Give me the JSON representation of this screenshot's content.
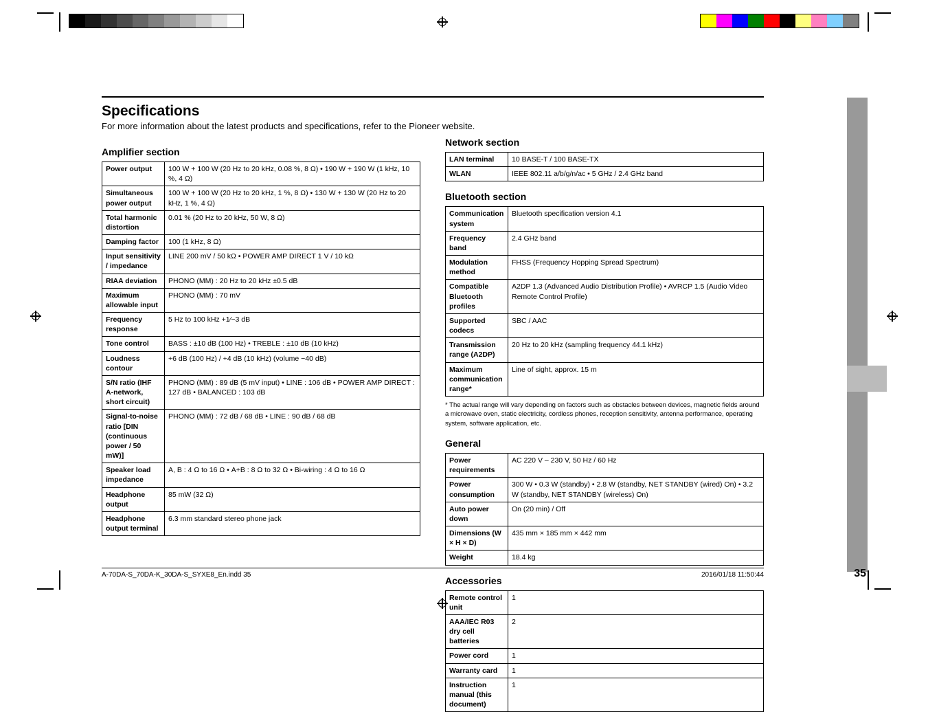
{
  "header": {
    "title": "Specifications",
    "subtitle": "For more information about the latest products and specifications, refer to the Pioneer website."
  },
  "amp": {
    "heading": "Amplifier section",
    "rows": [
      [
        "Power output",
        "100 W + 100 W (20 Hz to 20 kHz, 0.08 %, 8 Ω) • 190 W + 190 W (1 kHz, 10 %, 4 Ω)"
      ],
      [
        "Simultaneous power output",
        "100 W + 100 W (20 Hz to 20 kHz, 1 %, 8 Ω) • 130 W + 130 W (20 Hz to 20 kHz, 1 %, 4 Ω)"
      ],
      [
        "Total harmonic distortion",
        "0.01 % (20 Hz to 20 kHz, 50 W, 8 Ω)"
      ],
      [
        "Damping factor",
        "100 (1 kHz, 8 Ω)"
      ],
      [
        "Input sensitivity / impedance",
        "LINE  200 mV / 50 kΩ • POWER AMP DIRECT  1 V / 10 kΩ"
      ],
      [
        "RIAA deviation",
        "PHONO (MM) : 20 Hz to 20 kHz ±0.5 dB"
      ],
      [
        "Maximum allowable input",
        "PHONO (MM) : 70 mV"
      ],
      [
        "Frequency response",
        "5 Hz to 100 kHz  +1⁄−3 dB"
      ],
      [
        "Tone control",
        "BASS : ±10 dB (100 Hz) • TREBLE : ±10 dB (10 kHz)"
      ],
      [
        "Loudness contour",
        "+6 dB (100 Hz) / +4 dB (10 kHz)  (volume −40 dB)"
      ],
      [
        "S/N ratio (IHF A-network, short circuit)",
        "PHONO (MM) : 89 dB  (5 mV input) • LINE : 106 dB • POWER AMP DIRECT : 127 dB • BALANCED : 103 dB"
      ],
      [
        "Signal-to-noise ratio [DIN (continuous power / 50 mW)]",
        "PHONO (MM) : 72 dB / 68 dB • LINE : 90 dB / 68 dB"
      ],
      [
        "Speaker load impedance",
        "A, B : 4 Ω to 16 Ω • A+B : 8 Ω to 32 Ω • Bi-wiring : 4 Ω to 16 Ω"
      ],
      [
        "Headphone output",
        "85 mW (32 Ω)"
      ],
      [
        "Headphone output terminal",
        "6.3 mm standard stereo phone jack"
      ]
    ]
  },
  "net": {
    "heading": "Network section",
    "rows": [
      [
        "LAN terminal",
        "10 BASE-T / 100 BASE-TX"
      ],
      [
        "WLAN",
        "IEEE 802.11 a/b/g/n/ac • 5 GHz / 2.4 GHz band"
      ]
    ]
  },
  "bt": {
    "heading": "Bluetooth section",
    "rows": [
      [
        "Communication system",
        "Bluetooth specification version 4.1"
      ],
      [
        "Frequency band",
        "2.4 GHz band"
      ],
      [
        "Modulation method",
        "FHSS (Frequency Hopping Spread Spectrum)"
      ],
      [
        "Compatible Bluetooth profiles",
        "A2DP 1.3 (Advanced Audio Distribution Profile) • AVRCP 1.5 (Audio Video Remote Control Profile)"
      ],
      [
        "Supported codecs",
        "SBC / AAC"
      ],
      [
        "Transmission range (A2DP)",
        "20 Hz to 20 kHz (sampling frequency 44.1 kHz)"
      ],
      [
        "Maximum communication range*",
        "Line of sight, approx. 15 m"
      ]
    ],
    "note": "* The actual range will vary depending on factors such as obstacles between devices, magnetic fields around a microwave oven, static electricity, cordless phones, reception sensitivity, antenna performance, operating system, software application, etc."
  },
  "gen": {
    "heading": "General",
    "rows": [
      [
        "Power requirements",
        "AC 220 V – 230 V, 50 Hz / 60 Hz"
      ],
      [
        "Power consumption",
        "300 W • 0.3 W (standby) • 2.8 W (standby, NET STANDBY (wired) On) • 3.2 W (standby, NET STANDBY (wireless) On)"
      ],
      [
        "Auto power down",
        "On (20 min) / Off"
      ],
      [
        "Dimensions (W × H × D)",
        "435 mm × 185 mm × 442 mm"
      ],
      [
        "Weight",
        "18.4 kg"
      ]
    ]
  },
  "acc": {
    "heading": "Accessories",
    "rows": [
      [
        "Remote control unit",
        "1"
      ],
      [
        "AAA/IEC R03 dry cell batteries",
        "2"
      ],
      [
        "Power cord",
        "1"
      ],
      [
        "Warranty card",
        "1"
      ],
      [
        "Instruction manual (this document)",
        "1"
      ]
    ]
  },
  "footer": {
    "left": "A-70DA-S_70DA-K_30DA-S_SYXE8_En.indd   35",
    "right": "2016/01/18   11:50:44"
  },
  "pagenum": "35",
  "graybar": [
    "#000",
    "#1a1a1a",
    "#333",
    "#4d4d4d",
    "#666",
    "#808080",
    "#999",
    "#b3b3b3",
    "#ccc",
    "#e6e6e6",
    "#fff"
  ],
  "colorbar": [
    "#ff0",
    "#f0f",
    "#00f",
    "#008000",
    "#f00",
    "#000",
    "#ffff80",
    "#ff80c0",
    "#80d0ff",
    "#808080"
  ]
}
